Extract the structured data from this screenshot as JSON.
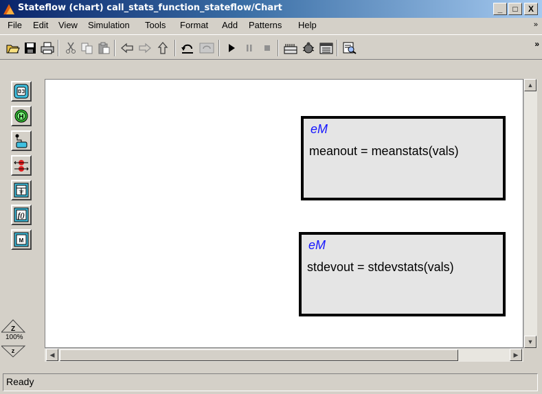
{
  "window": {
    "title": "Stateflow (chart) call_stats_function_stateflow/Chart",
    "controls": {
      "minimize": "_",
      "maximize": "□",
      "close": "X"
    }
  },
  "menubar": {
    "items": [
      "File",
      "Edit",
      "View",
      "Simulation",
      "Tools",
      "Format",
      "Add",
      "Patterns",
      "Help"
    ],
    "overflow": "»"
  },
  "toolbar": {
    "icons": [
      "open-icon",
      "save-icon",
      "print-icon",
      "cut-icon",
      "copy-icon",
      "paste-icon",
      "back-icon",
      "forward-icon",
      "up-icon",
      "undo-icon",
      "redo-icon",
      "start-icon",
      "pause-icon",
      "stop-icon",
      "build-icon",
      "debug-icon",
      "model-explorer-icon",
      "explore-icon"
    ],
    "overflow": "»"
  },
  "palette": {
    "tools": [
      "state-tool",
      "history-junction-tool",
      "default-transition-tool",
      "connective-junction-tool",
      "truth-table-tool",
      "embedded-function-tool",
      "box-tool"
    ],
    "zoom_level": "100%",
    "zoom_in": "Z",
    "zoom_out": "z"
  },
  "canvas": {
    "functions": [
      {
        "tag": "eM",
        "signature": "meanout = meanstats(vals)"
      },
      {
        "tag": "eM",
        "signature": "stdevout = stdevstats(vals)"
      }
    ]
  },
  "status": {
    "text": "Ready"
  },
  "colors": {
    "title_start": "#0a246a",
    "title_end": "#a6caf0",
    "function_tag": "#1414ff",
    "canvas": "#ffffff",
    "chrome": "#d4d0c8"
  }
}
